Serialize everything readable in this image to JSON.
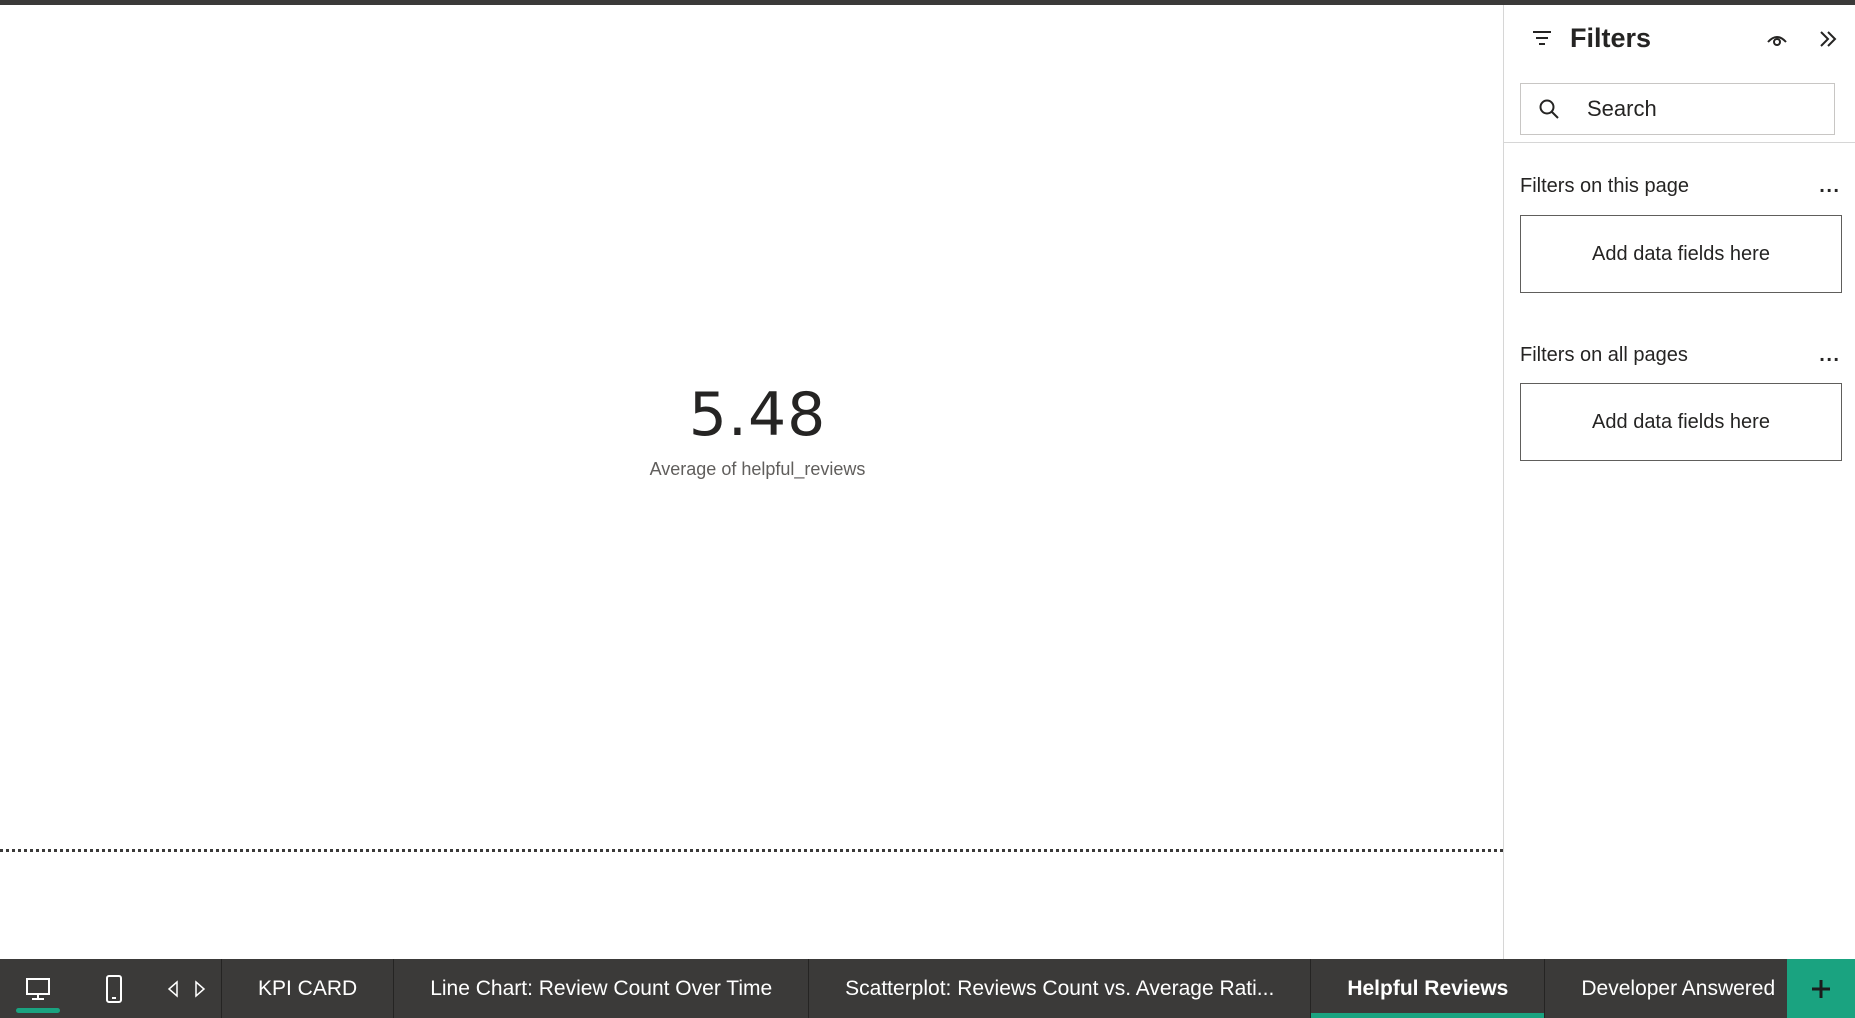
{
  "kpi": {
    "value": "5.48",
    "label": "Average of helpful_reviews"
  },
  "filters_pane": {
    "title": "Filters",
    "search_placeholder": "Search",
    "sections": [
      {
        "title": "Filters on this page",
        "well_text": "Add data fields here"
      },
      {
        "title": "Filters on all pages",
        "well_text": "Add data fields here"
      }
    ],
    "more_label": "..."
  },
  "tabs": {
    "pages": [
      {
        "label": "KPI CARD",
        "active": false
      },
      {
        "label": "Line Chart: Review Count Over Time",
        "active": false
      },
      {
        "label": "Scatterplot: Reviews Count vs. Average Rati...",
        "active": false
      },
      {
        "label": "Helpful Reviews",
        "active": true
      },
      {
        "label": "Developer Answered",
        "active": false
      }
    ],
    "add_label": "+"
  },
  "colors": {
    "accent": "#1aa380",
    "tabbar_bg": "#3b3a39",
    "text": "#252423"
  }
}
